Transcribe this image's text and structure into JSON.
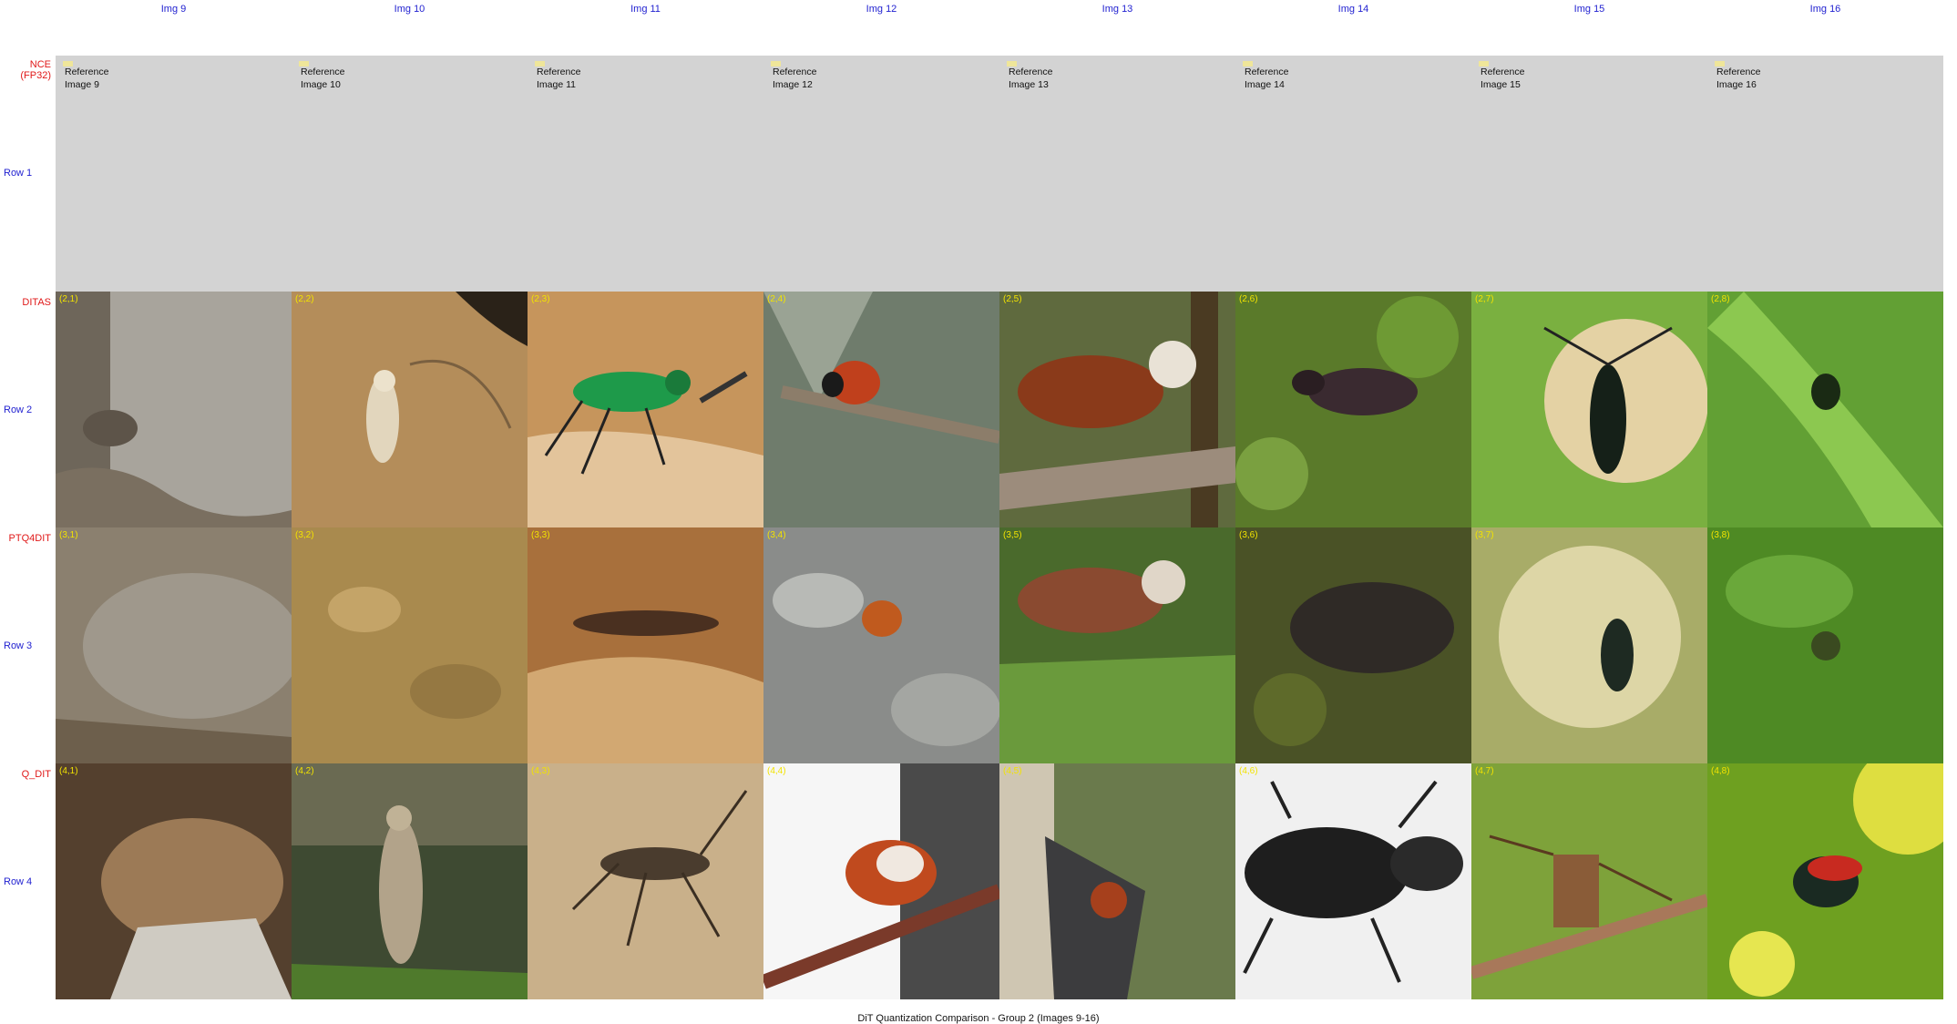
{
  "columns": [
    "Img 9",
    "Img 10",
    "Img 11",
    "Img 12",
    "Img 13",
    "Img 14",
    "Img 15",
    "Img 16"
  ],
  "rows": [
    {
      "method": "NCE (FP32)",
      "row_label": "Row 1"
    },
    {
      "method": "DITAS",
      "row_label": "Row 2"
    },
    {
      "method": "PTQ4DIT",
      "row_label": "Row 3"
    },
    {
      "method": "Q_DIT",
      "row_label": "Row 4"
    }
  ],
  "reference": {
    "title": "Reference",
    "images": [
      "Image 9",
      "Image 10",
      "Image 11",
      "Image 12",
      "Image 13",
      "Image 14",
      "Image 15",
      "Image 16"
    ]
  },
  "coords": [
    [
      "(2,1)",
      "(2,2)",
      "(2,3)",
      "(2,4)",
      "(2,5)",
      "(2,6)",
      "(2,7)",
      "(2,8)"
    ],
    [
      "(3,1)",
      "(3,2)",
      "(3,3)",
      "(3,4)",
      "(3,5)",
      "(3,6)",
      "(3,7)",
      "(3,8)"
    ],
    [
      "(4,1)",
      "(4,2)",
      "(4,3)",
      "(4,4)",
      "(4,5)",
      "(4,6)",
      "(4,7)",
      "(4,8)"
    ]
  ],
  "caption": "DiT Quantization Comparison - Group 2 (Images 9-16)"
}
